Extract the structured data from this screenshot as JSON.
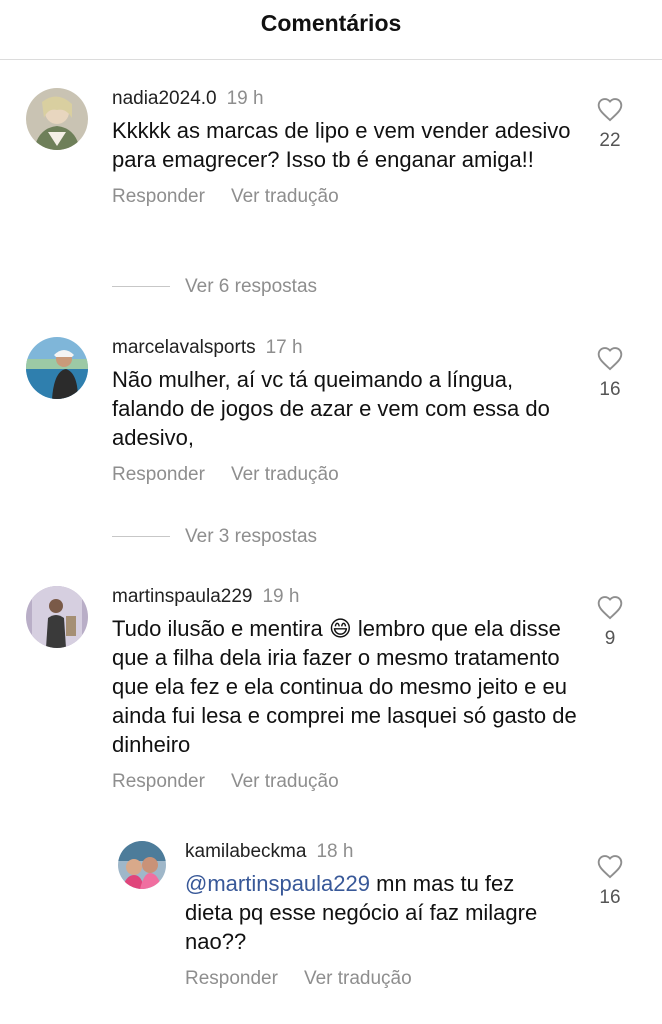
{
  "header": {
    "title": "Comentários"
  },
  "comments": [
    {
      "username": "nadia2024.0",
      "time": "19 h",
      "text": "Kkkkk as marcas de lipo e vem vender adesivo para emagrecer? Isso tb é enganar amiga!!",
      "likes": "22",
      "reply_label": "Responder",
      "translate_label": "Ver tradução",
      "view_replies": "Ver 6 respostas"
    },
    {
      "username": "marcelavalsports",
      "time": "17 h",
      "text": "Não mulher, aí vc tá queimando a língua, falando de jogos de azar e vem com essa do adesivo,",
      "likes": "16",
      "reply_label": "Responder",
      "translate_label": "Ver tradução",
      "view_replies": "Ver 3 respostas"
    },
    {
      "username": "martinspaula229",
      "time": "19 h",
      "text": "Tudo ilusão e mentira 😄 lembro que ela disse que a filha dela iria fazer o mesmo tratamento que ela fez e ela continua do mesmo jeito e eu ainda fui lesa e comprei me lasquei só gasto de dinheiro",
      "likes": "9",
      "reply_label": "Responder",
      "translate_label": "Ver tradução"
    },
    {
      "username": "kamilabeckma",
      "time": "18 h",
      "mention": "@martinspaula229",
      "text": " mn mas tu fez dieta pq esse negócio aí faz milagre nao??",
      "likes": "16",
      "reply_label": "Responder",
      "translate_label": "Ver tradução"
    }
  ],
  "icons": {
    "like": "heart-outline-icon"
  },
  "colors": {
    "mention": "#385898",
    "muted": "#8e8e8e"
  }
}
